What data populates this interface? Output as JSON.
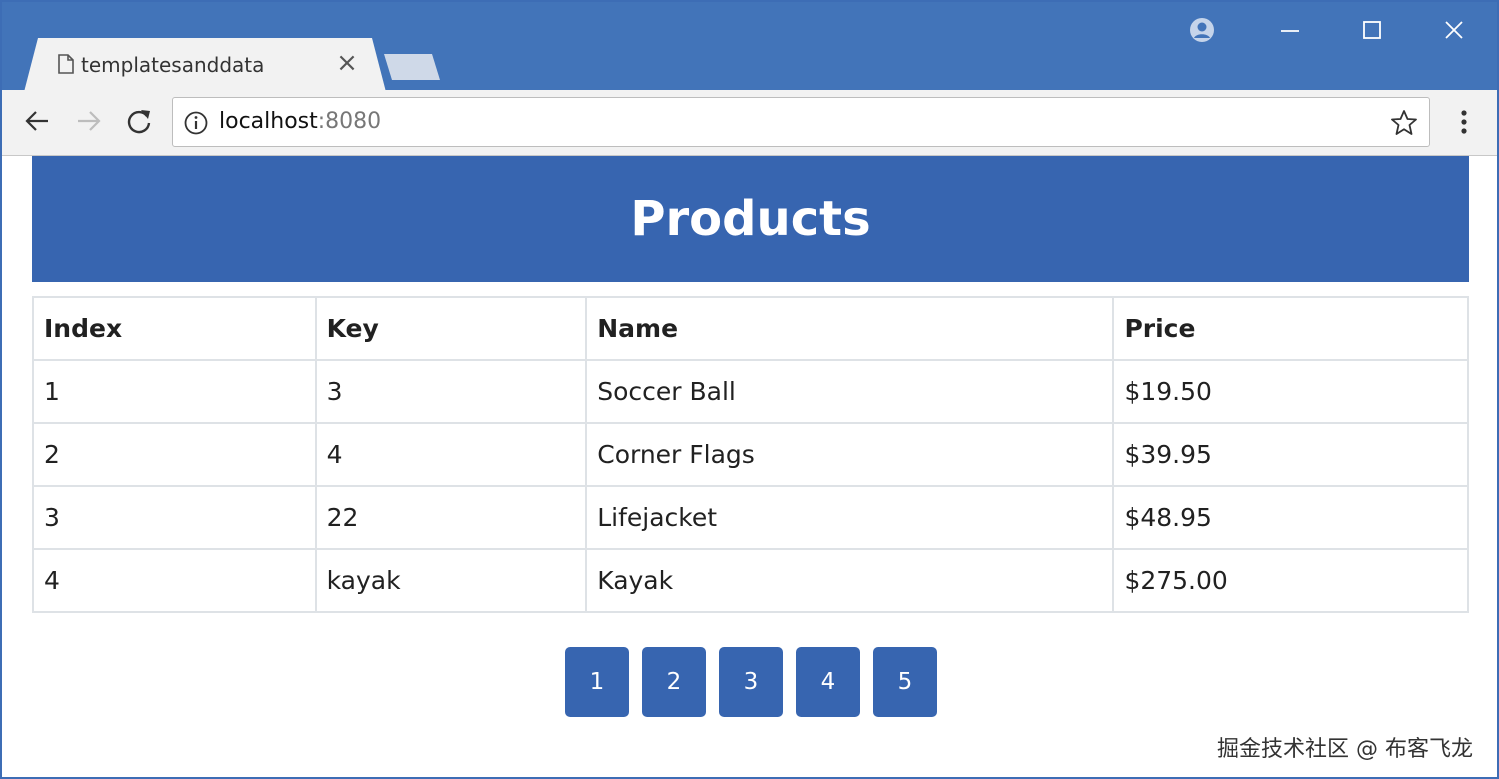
{
  "browser": {
    "tab": {
      "title": "templatesanddata",
      "close_label": "×"
    },
    "address_bar": {
      "host": "localhost",
      "port": ":8080"
    },
    "window_controls": {
      "close_label": "✕"
    },
    "icons": {
      "tab": "document-icon",
      "back": "arrow-left-icon",
      "forward": "arrow-right-icon",
      "reload": "reload-icon",
      "info": "info-icon",
      "bookmark": "star-icon",
      "menu": "kebab-menu-icon",
      "profile": "profile-icon"
    }
  },
  "page": {
    "title": "Products",
    "table": {
      "headers": [
        "Index",
        "Key",
        "Name",
        "Price"
      ],
      "rows": [
        [
          "1",
          "3",
          "Soccer Ball",
          "$19.50"
        ],
        [
          "2",
          "4",
          "Corner Flags",
          "$39.95"
        ],
        [
          "3",
          "22",
          "Lifejacket",
          "$48.95"
        ],
        [
          "4",
          "kayak",
          "Kayak",
          "$275.00"
        ]
      ]
    },
    "pagination": [
      "1",
      "2",
      "3",
      "4",
      "5"
    ]
  },
  "watermark": "掘金技术社区 @ 布客飞龙",
  "colors": {
    "chrome_frame": "#4274b9",
    "toolbar": "#f2f2f2",
    "banner": "#3765b0",
    "button": "#3765b0",
    "table_border": "#dee2e6"
  }
}
